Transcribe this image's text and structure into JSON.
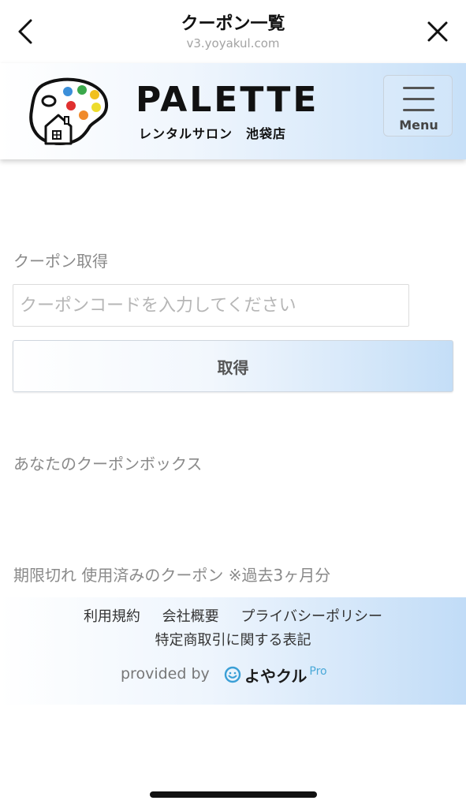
{
  "browser": {
    "title": "クーポン一覧",
    "url": "v3.yoyakul.com",
    "back_icon": "chevron-left-icon",
    "close_icon": "close-icon"
  },
  "header": {
    "brand_name": "PALETTE",
    "brand_sub": "レンタルサロン　池袋店",
    "menu_label": "Menu",
    "accent_color": "#c7e0f8"
  },
  "coupon": {
    "section_label": "クーポン取得",
    "input_placeholder": "クーポンコードを入力してください",
    "input_value": "",
    "acquire_label": "取得"
  },
  "coupon_box": {
    "label": "あなたのクーポンボックス"
  },
  "expired": {
    "label": "期限切れ 使用済みのクーポン ※過去3ヶ月分"
  },
  "footer": {
    "links": [
      "利用規約",
      "会社概要",
      "プライバシーポリシー"
    ],
    "link_commerce": "特定商取引に関する表記",
    "provided_by": "provided by",
    "provider_name": "よやクル",
    "provider_suffix": "Pro"
  }
}
